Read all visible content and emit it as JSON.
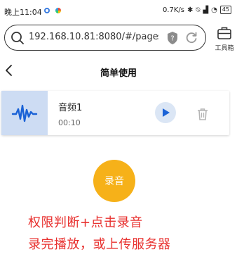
{
  "status_bar": {
    "time": "晚上11:04",
    "network_speed": "0.7K/s",
    "battery": "45"
  },
  "browser": {
    "url": "192.168.10.81:8080/#/pages/...",
    "toolbox_label": "工具箱"
  },
  "page": {
    "title": "简单使用"
  },
  "audio_list": [
    {
      "name": "音频1",
      "duration": "00:10"
    }
  ],
  "record_button_label": "录音",
  "notes": [
    "权限判断+点击录音",
    "录完播放，或上传服务器"
  ],
  "colors": {
    "accent": "#1a62d6",
    "record": "#f6b119",
    "note": "#e8312f",
    "wave_tile": "#cddcf3"
  }
}
